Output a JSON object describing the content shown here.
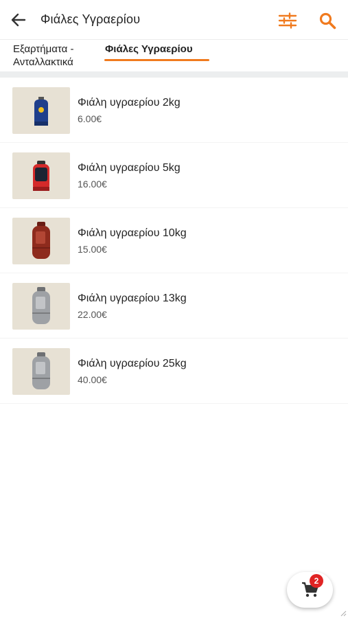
{
  "colors": {
    "accent": "#f07a1e",
    "badge": "#e02424",
    "thumb_bg": "#e7e1d4"
  },
  "header": {
    "title": "Φιάλες Υγραερίου",
    "back_icon": "arrow-left-icon",
    "filter_icon": "sliders-icon",
    "search_icon": "search-icon"
  },
  "tabs": [
    {
      "label": "Εξαρτήματα - Ανταλλακτικά",
      "selected": false
    },
    {
      "label": "Φιάλες Υγραερίου",
      "selected": true
    }
  ],
  "products": [
    {
      "name": "Φιάλη υγραερίου 2kg",
      "price": "6.00€",
      "image": "blue-gas-bottle"
    },
    {
      "name": "Φιάλη υγραερίου 5kg",
      "price": "16.00€",
      "image": "red-gas-bottle"
    },
    {
      "name": "Φιάλη υγραερίου 10kg",
      "price": "15.00€",
      "image": "red-composite-gas-bottle"
    },
    {
      "name": "Φιάλη υγραερίου 13kg",
      "price": "22.00€",
      "image": "grey-composite-gas-bottle"
    },
    {
      "name": "Φιάλη υγραερίου 25kg",
      "price": "40.00€",
      "image": "grey-composite-gas-bottle"
    }
  ],
  "cart": {
    "icon": "cart-icon",
    "count": "2"
  }
}
